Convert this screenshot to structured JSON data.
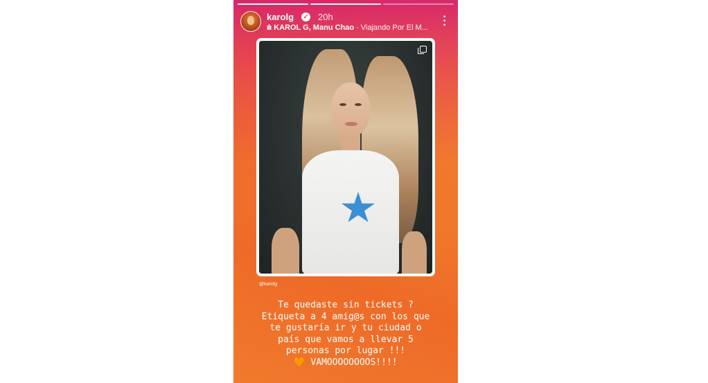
{
  "story": {
    "username": "karolg",
    "time": "20h",
    "music_artists": "KAROL G, Manu Chao",
    "music_separator": "·",
    "music_song": "Viajando Por El M...",
    "photo_credit": "@karolg",
    "caption_lines": [
      "Te quedaste sin tickets ?",
      "Etiqueta a 4 amig@s con los que",
      "te gustaría ir y tu ciudad o",
      "país que vamos a llevar 5",
      "personas por lugar !!!",
      "🧡 VAMOOOOOOOOS!!!!"
    ],
    "progress_total": 3,
    "progress_current": 1
  },
  "icons": {
    "verified": "verified-badge-icon",
    "music": "music-bars-icon",
    "more": "more-vertical-icon",
    "multi": "multiple-photos-icon"
  },
  "colors": {
    "gradient_top": "#d61c6e",
    "gradient_mid": "#f07b2a",
    "gradient_corner": "#f5c842",
    "star": "#3a8fd6"
  }
}
